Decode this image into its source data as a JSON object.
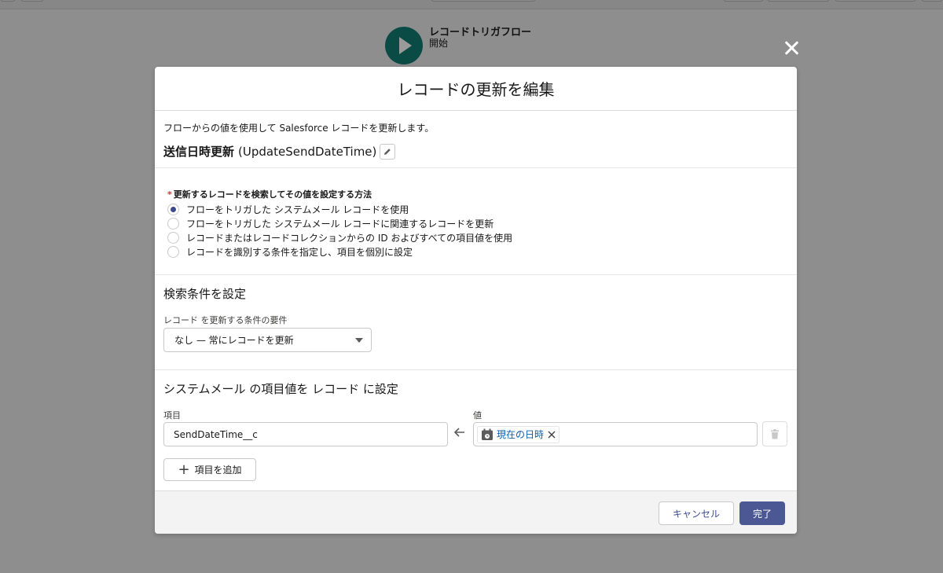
{
  "canvas": {
    "start_node_title": "レコードトリガフロー",
    "start_node_subtitle": "開始"
  },
  "modal": {
    "title": "レコードの更新を編集",
    "description": "フローからの値を使用して Salesforce レコードを更新します。",
    "element_label": "送信日時更新",
    "element_api_name": "(UpdateSendDateTime)",
    "how_to_find": {
      "label": "更新するレコードを検索してその値を設定する方法",
      "options": [
        {
          "label": "フローをトリガした システムメール レコードを使用",
          "selected": true
        },
        {
          "label": "フローをトリガした システムメール レコードに関連するレコードを更新",
          "selected": false
        },
        {
          "label": "レコードまたはレコードコレクションからの ID およびすべての項目値を使用",
          "selected": false
        },
        {
          "label": "レコードを識別する条件を指定し、項目を個別に設定",
          "selected": false
        }
      ]
    },
    "conditions": {
      "title": "検索条件を設定",
      "requirement_label": "レコード を更新する条件の要件",
      "requirement_value": "なし — 常にレコードを更新"
    },
    "assignments": {
      "title": "システムメール の項目値を レコード に設定",
      "field_label": "項目",
      "value_label": "値",
      "field_value": "SendDateTime__c",
      "value_pill": "現在の日時",
      "add_field_label": "項目を追加"
    },
    "footer": {
      "cancel_label": "キャンセル",
      "done_label": "完了"
    }
  },
  "colors": {
    "brand": "#4c5893",
    "link": "#0b5cab",
    "required": "#c23934"
  },
  "icons": [
    "close-icon",
    "pencil-icon",
    "arrow-left-icon",
    "calendar-icon",
    "remove-icon",
    "trash-icon",
    "plus-icon",
    "play-icon"
  ]
}
